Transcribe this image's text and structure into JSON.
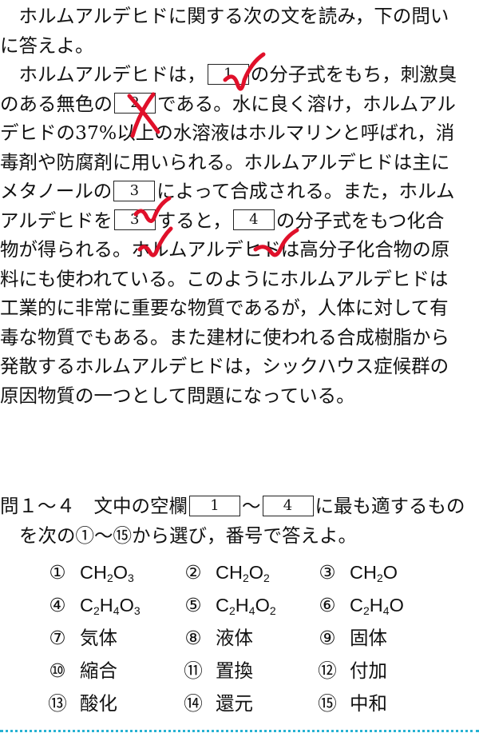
{
  "passage": {
    "lines": [
      {
        "segments": [
          {
            "t": "　ホルムアルデヒドに関する次の文を読み，下の問い"
          }
        ]
      },
      {
        "segments": [
          {
            "t": "に答えよ。"
          }
        ]
      },
      {
        "segments": [
          {
            "t": "　ホルムアルデヒドは，"
          },
          {
            "box": "1"
          },
          {
            "t": "の分子式をもち，刺激臭"
          }
        ]
      },
      {
        "segments": [
          {
            "t": "のある無色の"
          },
          {
            "box": "2"
          },
          {
            "t": "である。水に良く溶け，ホルムアル"
          }
        ]
      },
      {
        "segments": [
          {
            "t": "デヒドの37%以上の水溶液はホルマリンと呼ばれ，消"
          }
        ]
      },
      {
        "segments": [
          {
            "t": "毒剤や防腐剤に用いられる。ホルムアルデヒドは主に"
          }
        ]
      },
      {
        "segments": [
          {
            "t": "メタノールの"
          },
          {
            "box": "3"
          },
          {
            "t": "によって合成される。また，ホルム"
          }
        ]
      },
      {
        "segments": [
          {
            "t": "アルデヒドを"
          },
          {
            "box": "3"
          },
          {
            "t": "すると，"
          },
          {
            "box": "4"
          },
          {
            "t": "の分子式をもつ化合"
          }
        ]
      },
      {
        "segments": [
          {
            "t": "物が得られる。ホルムアルデヒドは高分子化合物の原"
          }
        ]
      },
      {
        "segments": [
          {
            "t": "料にも使われている。このようにホルムアルデヒドは"
          }
        ]
      },
      {
        "segments": [
          {
            "t": "工業的に非常に重要な物質であるが，人体に対して有"
          }
        ]
      },
      {
        "segments": [
          {
            "t": "毒な物質でもある。また建材に使われる合成樹脂から"
          }
        ]
      },
      {
        "segments": [
          {
            "t": "発散するホルムアルデヒドは，シックハウス症候群の"
          }
        ]
      },
      {
        "segments": [
          {
            "t": "原因物質の一つとして問題になっている。"
          }
        ]
      }
    ]
  },
  "question": {
    "line1_prefix": "問１～４　文中の空欄",
    "box_start": "1",
    "tilde": "～",
    "box_end": "4",
    "line1_suffix": "に最も適するもの",
    "line2": "を次の①～⑮から選び，番号で答えよ。"
  },
  "options": [
    {
      "num": "①",
      "html": "CH<sub>2</sub>O<sub>3</sub>"
    },
    {
      "num": "②",
      "html": "CH<sub>2</sub>O<sub>2</sub>"
    },
    {
      "num": "③",
      "html": "CH<sub>2</sub>O"
    },
    {
      "num": "④",
      "html": "C<sub>2</sub>H<sub>4</sub>O<sub>3</sub>"
    },
    {
      "num": "⑤",
      "html": "C<sub>2</sub>H<sub>4</sub>O<sub>2</sub>"
    },
    {
      "num": "⑥",
      "html": "C<sub>2</sub>H<sub>4</sub>O"
    },
    {
      "num": "⑦",
      "html": "気体"
    },
    {
      "num": "⑧",
      "html": "液体"
    },
    {
      "num": "⑨",
      "html": "固体"
    },
    {
      "num": "⑩",
      "html": "縮合"
    },
    {
      "num": "⑪",
      "html": "置換"
    },
    {
      "num": "⑫",
      "html": "付加"
    },
    {
      "num": "⑬",
      "html": "酸化"
    },
    {
      "num": "⑭",
      "html": "還元"
    },
    {
      "num": "⑮",
      "html": "中和"
    }
  ],
  "colors": {
    "mark": "#e0102a",
    "dotted_rule": "#27b2d3"
  },
  "marks": [
    "check",
    "cross",
    "check",
    "check",
    "check"
  ]
}
